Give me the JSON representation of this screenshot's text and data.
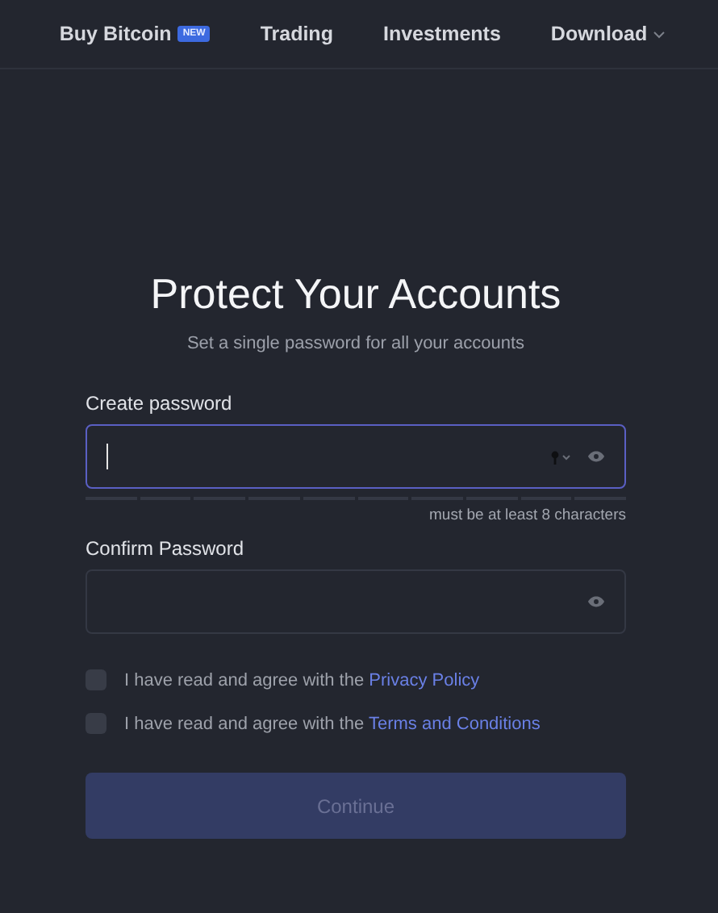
{
  "nav": [
    {
      "label": "Buy Bitcoin",
      "badge": "NEW",
      "dropdown": false
    },
    {
      "label": "Trading",
      "dropdown": false
    },
    {
      "label": "Investments",
      "dropdown": false
    },
    {
      "label": "Download",
      "dropdown": true
    }
  ],
  "title": "Protect Your Accounts",
  "subtitle": "Set a single password for all your accounts",
  "fields": [
    {
      "label": "Create password",
      "focused": true,
      "key_menu": true,
      "hint": "must be at least 8 characters"
    },
    {
      "label": "Confirm Password",
      "focused": false,
      "key_menu": false
    }
  ],
  "agreements": [
    {
      "text": "I have read and agree with the",
      "link": "Privacy Policy",
      "checked": false
    },
    {
      "text": "I have read and agree with the",
      "link": "Terms and Conditions",
      "checked": false
    }
  ],
  "button": {
    "label": "Continue",
    "disabled": true
  }
}
